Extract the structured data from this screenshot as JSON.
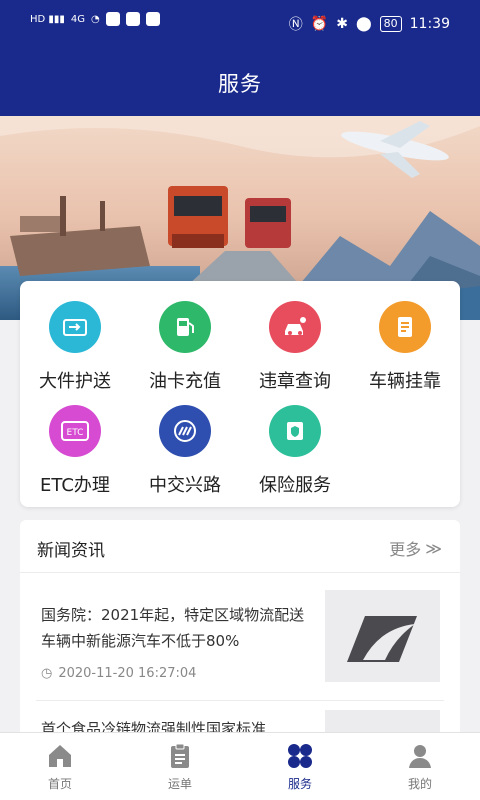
{
  "status_bar": {
    "time": "11:39",
    "battery": "80",
    "network": "4G"
  },
  "header": {
    "title": "服务"
  },
  "services": [
    {
      "label": "大件护送",
      "icon": "truck-escort-icon",
      "color": "#2bb8d6"
    },
    {
      "label": "油卡充值",
      "icon": "fuel-pump-icon",
      "color": "#2eb86a"
    },
    {
      "label": "违章查询",
      "icon": "car-violation-icon",
      "color": "#e84d5e"
    },
    {
      "label": "车辆挂靠",
      "icon": "document-icon",
      "color": "#f39c2c"
    },
    {
      "label": "ETC办理",
      "icon": "etc-icon",
      "color": "#d64bd1"
    },
    {
      "label": "中交兴路",
      "icon": "zhongjiao-logo-icon",
      "color": "#2f4fb0"
    },
    {
      "label": "保险服务",
      "icon": "shield-insurance-icon",
      "color": "#2cbf9a"
    }
  ],
  "news": {
    "title": "新闻资讯",
    "more": "更多",
    "items": [
      {
        "headline": "国务院：2021年起，特定区域物流配送车辆中新能源汽车不低于80%",
        "time": "2020-11-20 16:27:04"
      },
      {
        "headline": "首个食品冷链物流强制性国家标准",
        "time": ""
      }
    ]
  },
  "tabs": [
    {
      "label": "首页",
      "icon": "home-icon"
    },
    {
      "label": "运单",
      "icon": "clipboard-icon"
    },
    {
      "label": "服务",
      "icon": "grid-services-icon",
      "active": true
    },
    {
      "label": "我的",
      "icon": "user-icon"
    }
  ]
}
